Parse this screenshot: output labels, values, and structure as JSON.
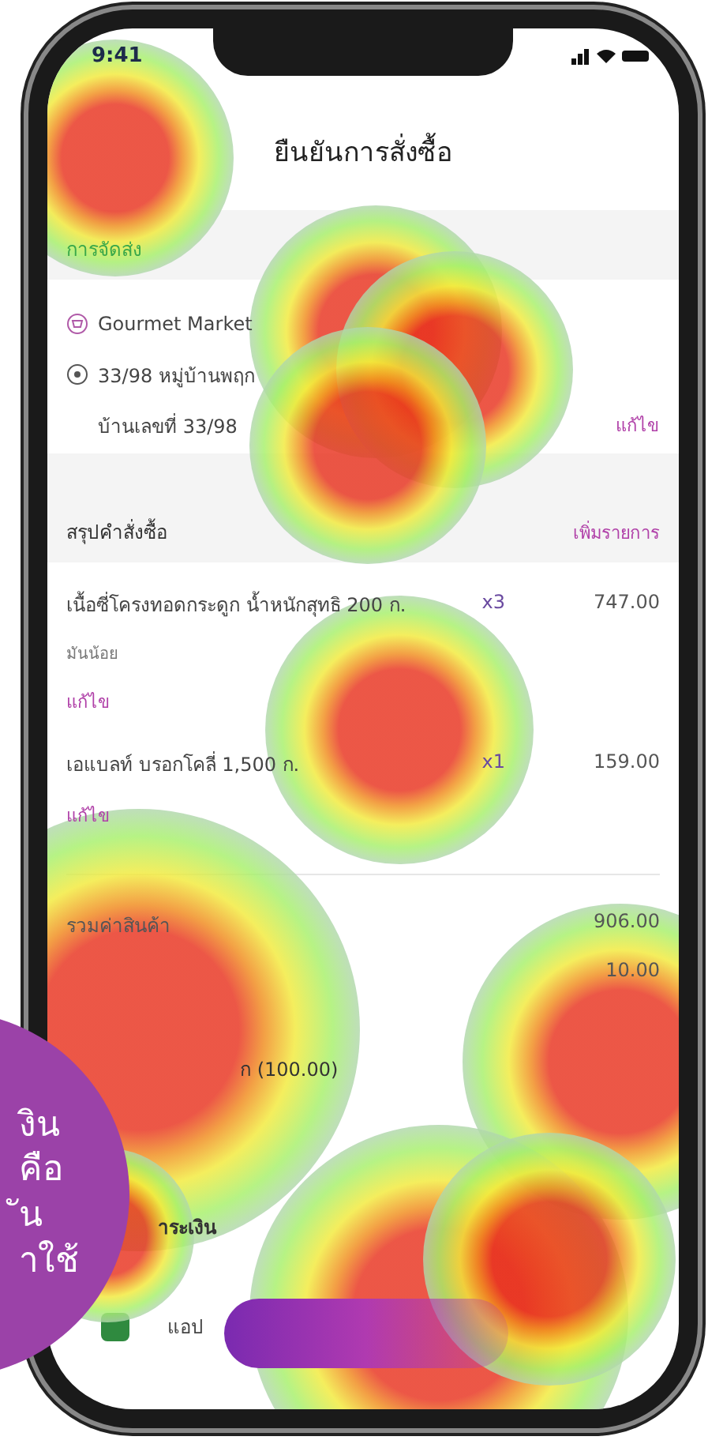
{
  "status_bar": {
    "time": "9:41"
  },
  "header": {
    "title": "ยืนยันการสั่งซื้อ"
  },
  "delivery": {
    "section_title": "การจัดส่ง",
    "store": "Gourmet Market",
    "address_short": "33/98 หมู่บ้านพฤก",
    "address_detail": "บ้านเลขที่ 33/98",
    "edit": "แก้ไข"
  },
  "summary": {
    "section_title": "สรุปคำสั่งซื้อ",
    "add_items": "เพิ่มรายการ",
    "items": [
      {
        "name": "เนื้อซี่โครงทอดกระดูก น้ำหนักสุทธิ 200 ก.",
        "quantity": "x3",
        "price": "747.00",
        "note": "มันน้อย",
        "edit": "แก้ไข"
      },
      {
        "name": "เอแบลท์ บรอกโคลี่ 1,500 ก.",
        "quantity": "x1",
        "price": "159.00",
        "edit": "แก้ไข"
      }
    ]
  },
  "totals": [
    {
      "label": "รวมค่าสินค้า",
      "value": "906.00"
    },
    {
      "value": "10.00"
    },
    {
      "label": "ก (100.00)"
    }
  ],
  "payment": {
    "section_title": "าระเงิน"
  },
  "bottom_bar": {
    "label": "แอป"
  },
  "promo_bubble": {
    "lines": [
      "งิน",
      "คือ",
      "ัน",
      "าใช้"
    ]
  }
}
